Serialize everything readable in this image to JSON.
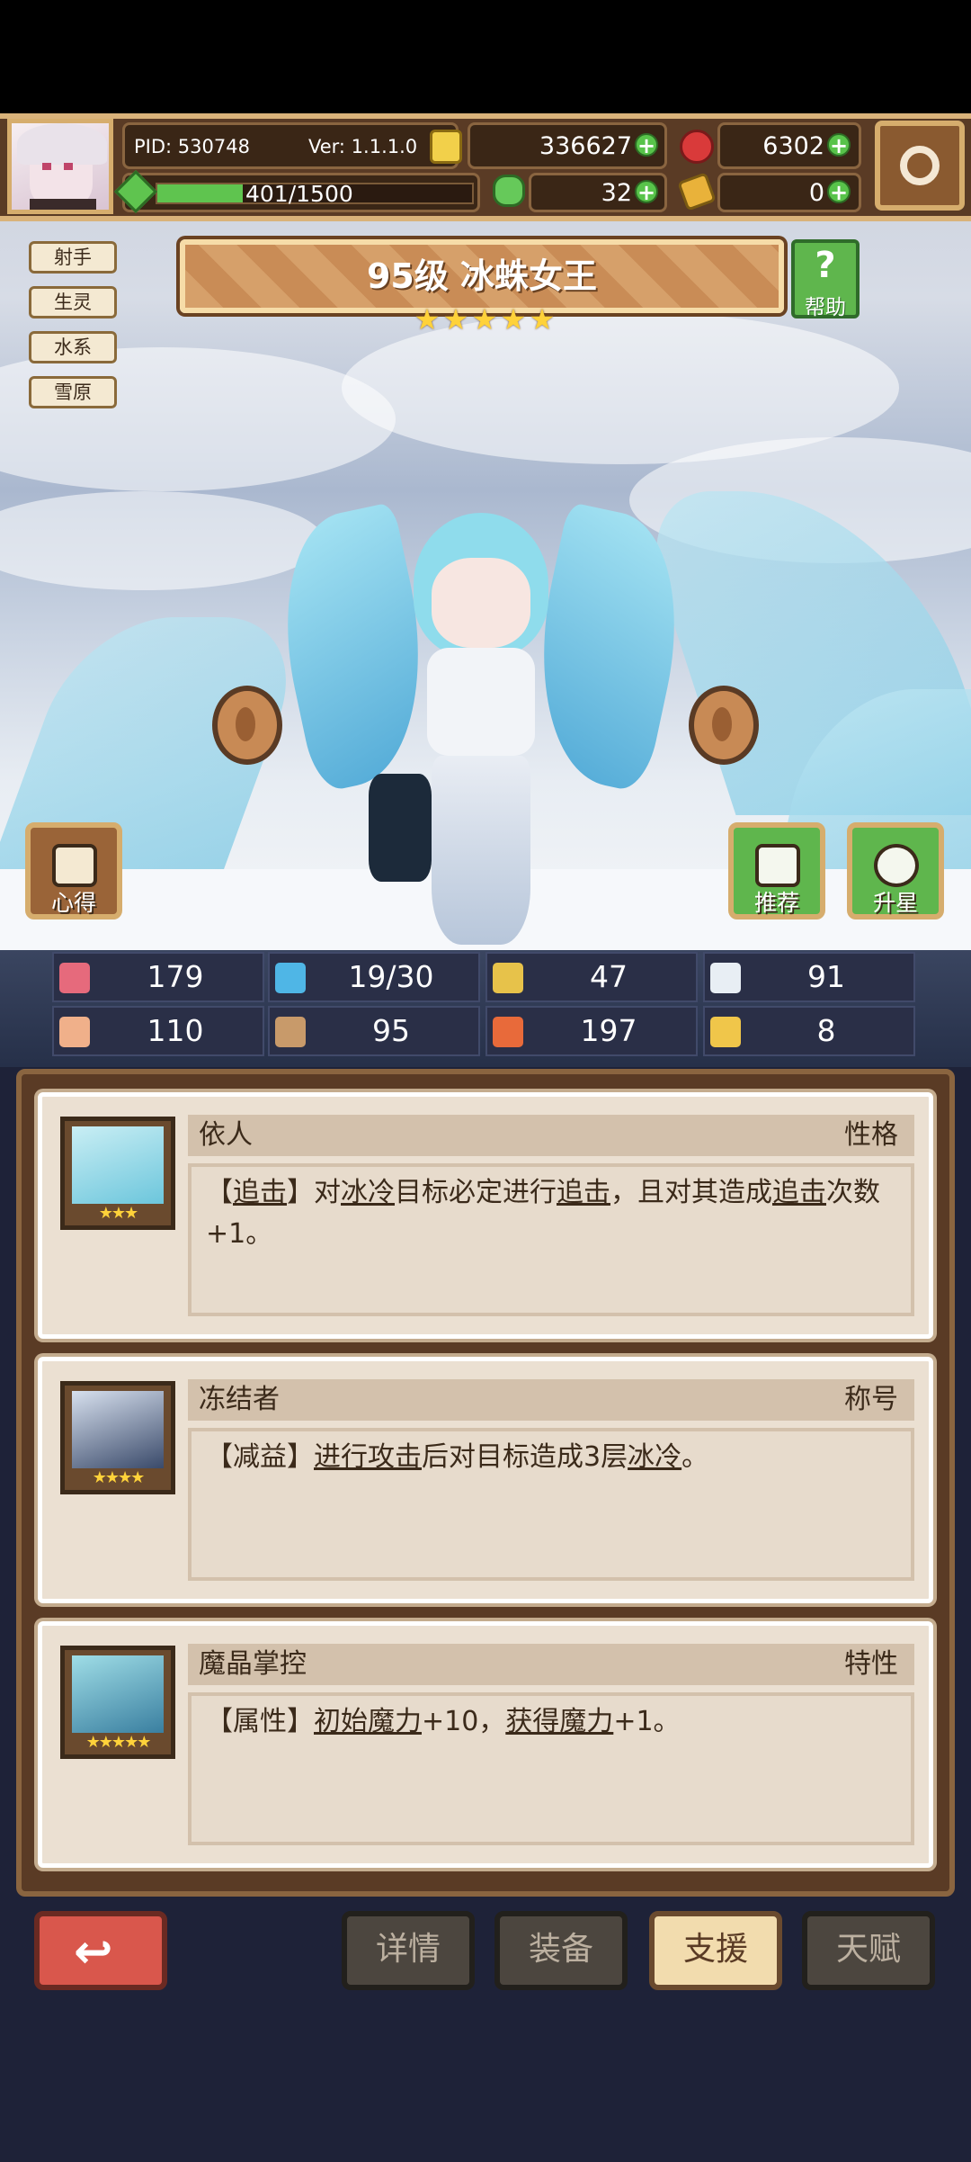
{
  "player": {
    "pid": "PID: 530748",
    "version": "Ver: 1.1.1.0",
    "gold": "336627",
    "gems": "6302",
    "stamina": "401/1500",
    "stamina_fill": 0.27,
    "clover": "32",
    "keys": "0"
  },
  "tags": [
    "射手",
    "生灵",
    "水系",
    "雪原"
  ],
  "hero": {
    "title": "95级 冰蛛女王",
    "stars": 5,
    "help_label": "帮助"
  },
  "side_buttons": {
    "insight": "心得",
    "recommend": "推荐",
    "star_up": "升星"
  },
  "stats": [
    {
      "icon": "heart-icon",
      "value": "179",
      "color": "#e66a7c"
    },
    {
      "icon": "water-drop-icon",
      "value": "19/30",
      "color": "#4fb6e6"
    },
    {
      "icon": "shield-icon",
      "value": "47",
      "color": "#e7c24a"
    },
    {
      "icon": "wing-icon",
      "value": "91",
      "color": "#e8eef4"
    },
    {
      "icon": "fist-icon",
      "value": "110",
      "color": "#f0b08a"
    },
    {
      "icon": "book-icon",
      "value": "95",
      "color": "#c89a6a"
    },
    {
      "icon": "card-icon",
      "value": "197",
      "color": "#e86a3a"
    },
    {
      "icon": "horseshoe-icon",
      "value": "8",
      "color": "#f0c64a"
    }
  ],
  "cards": [
    {
      "name": "依人",
      "type": "性格",
      "stars": "★★★",
      "desc_parts": [
        {
          "t": "【",
          "u": false
        },
        {
          "t": "追击",
          "u": true
        },
        {
          "t": "】对",
          "u": false
        },
        {
          "t": "冰冷",
          "u": true
        },
        {
          "t": "目标必定进行",
          "u": false
        },
        {
          "t": "追击",
          "u": true
        },
        {
          "t": "，且对其造成",
          "u": false
        },
        {
          "t": "追击",
          "u": true
        },
        {
          "t": "次数+1。",
          "u": false
        }
      ]
    },
    {
      "name": "冻结者",
      "type": "称号",
      "stars": "★★★★",
      "desc_parts": [
        {
          "t": "【减益】",
          "u": false
        },
        {
          "t": "进行攻击",
          "u": true
        },
        {
          "t": "后对目标造成3层",
          "u": false
        },
        {
          "t": "冰冷",
          "u": true
        },
        {
          "t": "。",
          "u": false
        }
      ]
    },
    {
      "name": "魔晶掌控",
      "type": "特性",
      "stars": "★★★★★",
      "desc_parts": [
        {
          "t": "【属性】",
          "u": false
        },
        {
          "t": "初始魔力",
          "u": true
        },
        {
          "t": "+10，",
          "u": false
        },
        {
          "t": "获得魔力",
          "u": true
        },
        {
          "t": "+1。",
          "u": false
        }
      ]
    }
  ],
  "bottom_tabs": [
    "详情",
    "装备",
    "支援",
    "天赋"
  ],
  "active_tab": "支援"
}
